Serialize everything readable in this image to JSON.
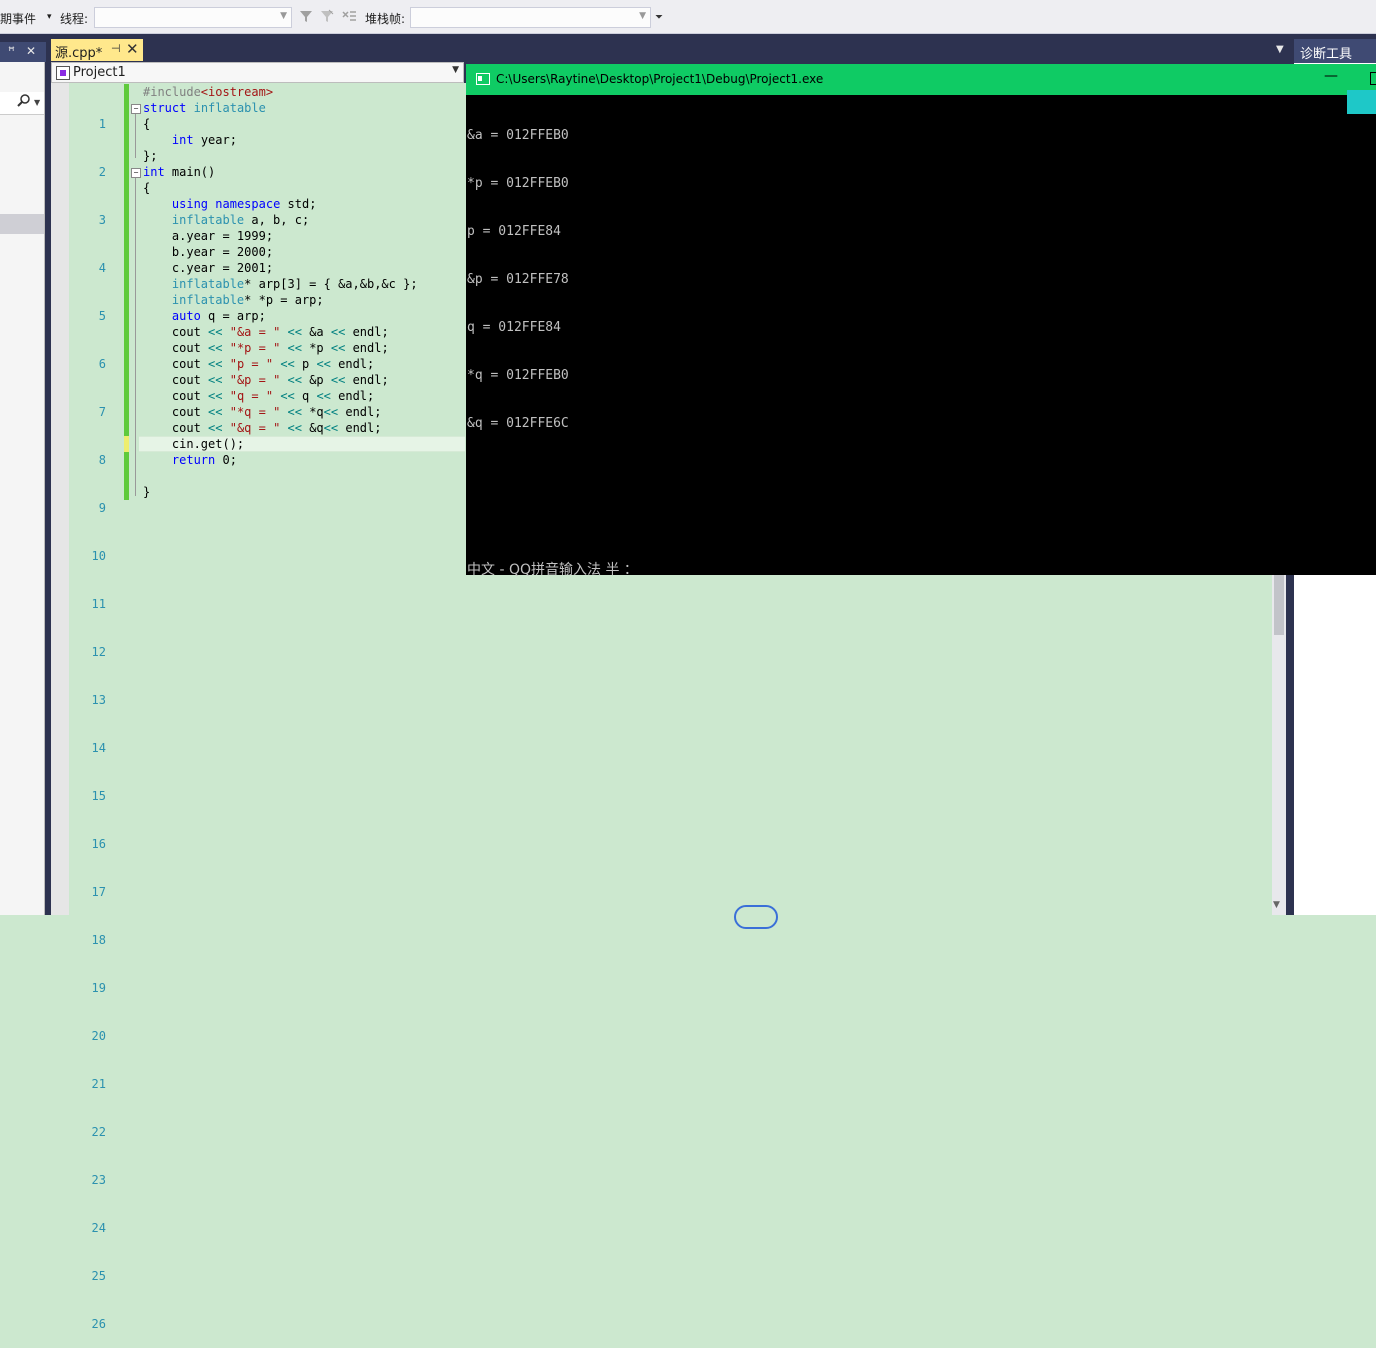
{
  "toolbar": {
    "lifecycle_label": "期事件",
    "lifecycle_arrow": "▾",
    "thread_label": "线程:",
    "stackframe_label": "堆栈帧:",
    "thread_value": "",
    "stackframe_value": "",
    "icons": [
      "filter-icon",
      "filter-clear-icon",
      "threads-flag-icon",
      "overflow-icon"
    ]
  },
  "left_panel": {
    "pin": "ꟸ",
    "close": "✕",
    "search_icon": "🔍"
  },
  "document": {
    "tab_label": "源.cpp*",
    "tab_pin": "⊣",
    "tab_close": "✕",
    "nav_project": "Project1",
    "overflow_arrow": "▼"
  },
  "diagnostics": {
    "tab_label": "诊断工具"
  },
  "code": {
    "line_numbers": [
      "1",
      "2",
      "3",
      "4",
      "5",
      "6",
      "7",
      "8",
      "9",
      "10",
      "11",
      "12",
      "13",
      "14",
      "15",
      "16",
      "17",
      "18",
      "19",
      "20",
      "21",
      "22",
      "23",
      "24",
      "25",
      "26"
    ]
  },
  "console": {
    "title": "C:\\Users\\Raytine\\Desktop\\Project1\\Debug\\Project1.exe",
    "minimize": "—",
    "output": [
      "&a = 012FFEB0",
      "*p = 012FFEB0",
      "p = 012FFE84",
      "&p = 012FFE78",
      "q = 012FFE84",
      "*q = 012FFEB0",
      "&q = 012FFE6C"
    ],
    "ime_status": "中文 - QQ拼音输入法 半 ："
  },
  "colors": {
    "editor_bg": "#cce8cf",
    "console_title_bg": "#0fcb64",
    "keyword": "#0000ff",
    "type": "#2b91af",
    "string": "#a31515",
    "change_bar": "#5fca3c"
  }
}
